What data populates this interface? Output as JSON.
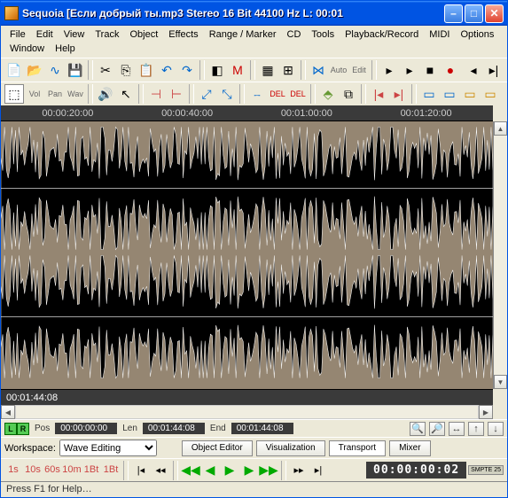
{
  "window": {
    "title": "Sequoia  [Если  добрый  ты.mp3  Stereo 16 Bit 44100 Hz L: 00:01"
  },
  "menu": {
    "items": [
      "File",
      "Edit",
      "View",
      "Track",
      "Object",
      "Effects",
      "Range / Marker",
      "CD",
      "Tools",
      "Playback/Record",
      "MIDI",
      "Options",
      "Window",
      "Help"
    ]
  },
  "timeline": {
    "marks": [
      "00:00:20:00",
      "00:00:40:00",
      "00:01:00:00",
      "00:01:20:00"
    ]
  },
  "posbar": {
    "value": "00:01:44:08"
  },
  "info": {
    "L": "L",
    "R": "R",
    "pos_lbl": "Pos",
    "pos_val": "00:00:00:00",
    "len_lbl": "Len",
    "len_val": "00:01:44:08",
    "end_lbl": "End",
    "end_val": "00:01:44:08"
  },
  "workspace": {
    "label": "Workspace:",
    "value": "Wave Editing",
    "tabs": [
      "Object Editor",
      "Visualization",
      "Transport",
      "Mixer"
    ],
    "active": 2
  },
  "markers": [
    "1s",
    "10s",
    "60s",
    "10m",
    "1Bt",
    "1Bt"
  ],
  "timecode": "00:00:00:02",
  "smpte": "SMPTE\n25",
  "status": "Press F1 for Help…",
  "colors": {
    "wave_bg": "#958672",
    "panel": "#3a3a3a",
    "accent": "#0054e3"
  }
}
